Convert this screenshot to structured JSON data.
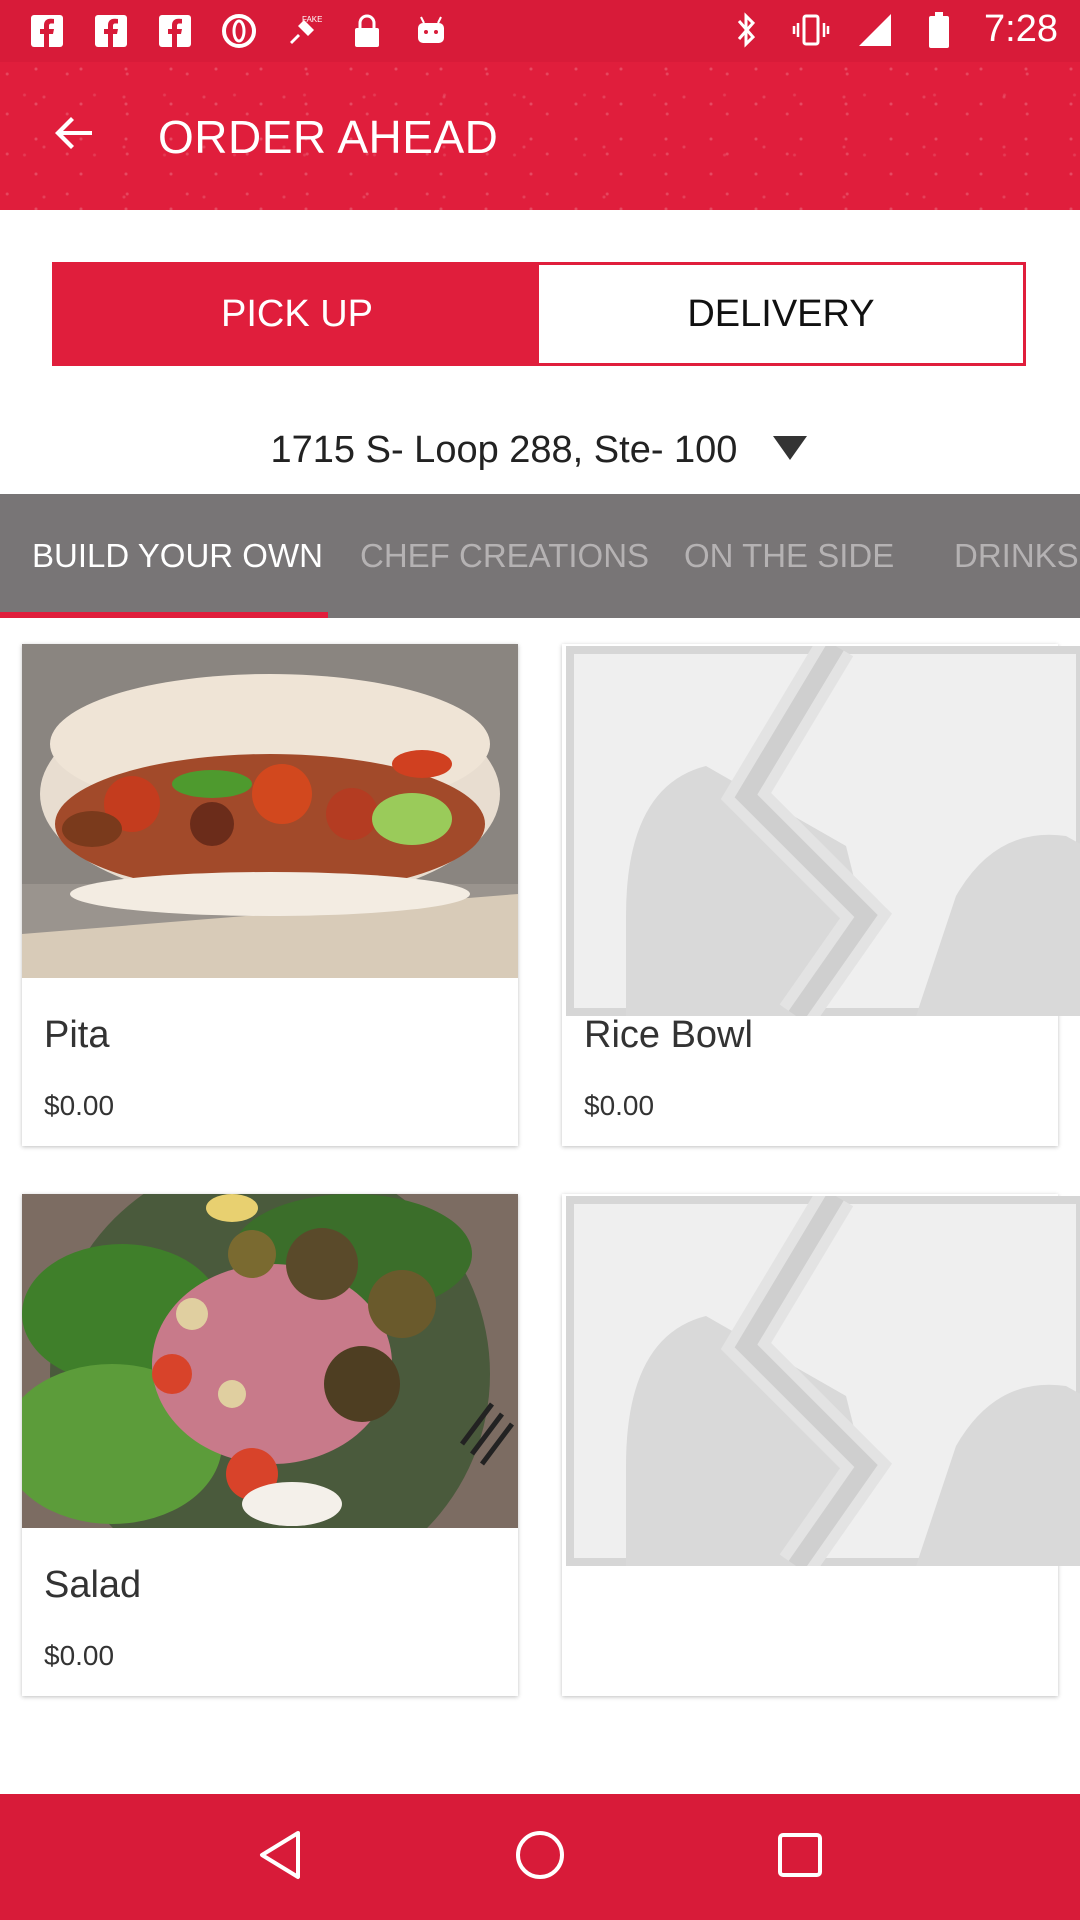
{
  "status_bar": {
    "time": "7:28",
    "icons_left": [
      "facebook-icon",
      "facebook-icon",
      "facebook-icon",
      "opera-icon",
      "fake-gps-icon",
      "lock-icon",
      "android-icon"
    ],
    "icons_right": [
      "bluetooth-icon",
      "vibrate-icon",
      "signal-icon",
      "battery-icon"
    ]
  },
  "app_bar": {
    "title": "ORDER AHEAD",
    "back_icon": "arrow-left-icon"
  },
  "mode_tabs": [
    {
      "label": "PICK UP",
      "active": true
    },
    {
      "label": "DELIVERY",
      "active": false
    }
  ],
  "location": {
    "address": "1715 S- Loop 288, Ste- 100",
    "dropdown_icon": "triangle-down-icon"
  },
  "categories": [
    {
      "label": "BUILD YOUR OWN",
      "active": true
    },
    {
      "label": "CHEF CREATIONS",
      "active": false
    },
    {
      "label": "ON THE SIDE",
      "active": false
    },
    {
      "label": "DRINKS",
      "active": false
    }
  ],
  "items": [
    {
      "name": "Pita",
      "price": "$0.00",
      "image": "pita-photo"
    },
    {
      "name": "Rice Bowl",
      "price": "$0.00",
      "image": "placeholder-image-icon"
    },
    {
      "name": "Salad",
      "price": "$0.00",
      "image": "salad-photo"
    },
    {
      "name": "",
      "price": "",
      "image": "placeholder-image-icon"
    }
  ],
  "nav_bar": [
    "back-triangle-icon",
    "home-circle-icon",
    "recents-square-icon"
  ],
  "colors": {
    "primary_red": "#e01e3c",
    "status_red": "#d81b39",
    "category_bar_gray": "#787576",
    "inactive_tab_text": "#b5b2b3"
  }
}
